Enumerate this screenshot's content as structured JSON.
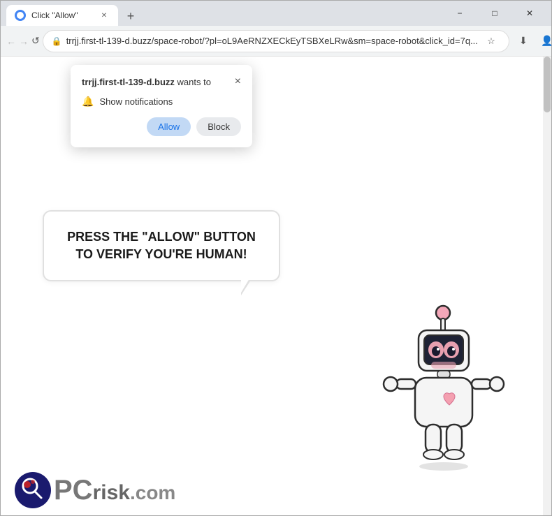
{
  "window": {
    "title": "Click \"Allow\"",
    "favicon": "🌐"
  },
  "tabs": [
    {
      "id": "tab1",
      "title": "Click \"Allow\"",
      "active": true
    }
  ],
  "titlebar": {
    "minimize": "−",
    "restore": "□",
    "close": "✕",
    "new_tab_icon": "+"
  },
  "navbar": {
    "back_icon": "←",
    "forward_icon": "→",
    "reload_icon": "↺",
    "url": "trrjj.first-tl-139-d.buzz/space-robot/?pl=oL9AeRNZXECkEyTSBXeLRw&sm=space-robot&click_id=7q...",
    "bookmark_icon": "☆",
    "download_icon": "⬇",
    "profile_icon": "👤",
    "menu_icon": "⋮"
  },
  "notification_popup": {
    "domain_bold": "trrjj.first-tl-139-d.buzz",
    "wants_text": " wants to",
    "close_icon": "×",
    "bell_icon": "🔔",
    "show_notifications": "Show notifications",
    "allow_label": "Allow",
    "block_label": "Block"
  },
  "page": {
    "speech_bubble_text": "PRESS THE \"ALLOW\" BUTTON TO VERIFY YOU'RE HUMAN!"
  },
  "pcrisk": {
    "logo_text": "PC",
    "risk_text": "risk",
    "com_text": ".com"
  }
}
